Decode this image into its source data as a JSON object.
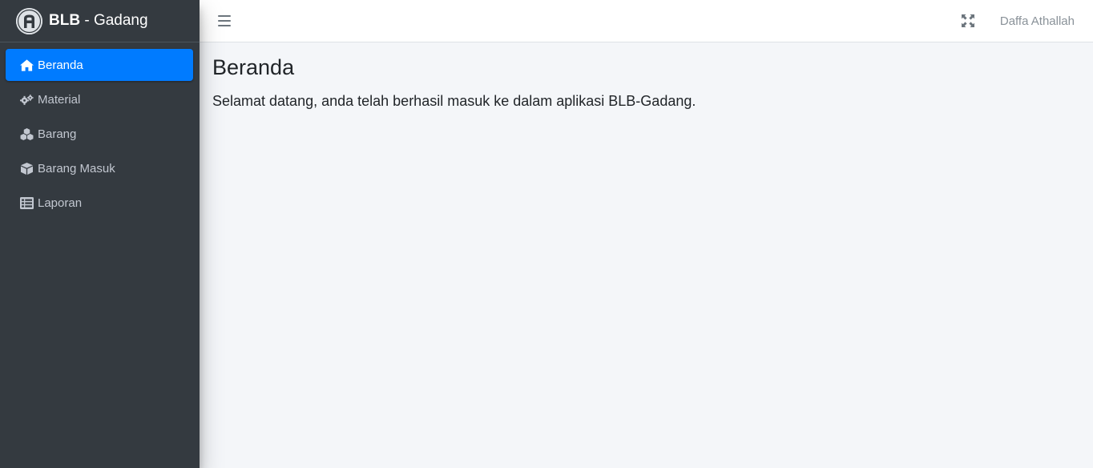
{
  "brand": {
    "bold": "BLB",
    "light": " - Gadang"
  },
  "sidebar": {
    "items": [
      {
        "label": "Beranda",
        "icon": "home-icon"
      },
      {
        "label": "Material",
        "icon": "gears-icon"
      },
      {
        "label": "Barang",
        "icon": "cubes-icon"
      },
      {
        "label": "Barang Masuk",
        "icon": "box-icon"
      },
      {
        "label": "Laporan",
        "icon": "list-icon"
      }
    ],
    "active_index": 0
  },
  "topbar": {
    "user_name": "Daffa Athallah"
  },
  "main": {
    "title": "Beranda",
    "welcome": "Selamat datang, anda telah berhasil masuk ke dalam aplikasi BLB-Gadang."
  },
  "colors": {
    "sidebar_bg": "#343a40",
    "active_item": "#007bff",
    "content_bg": "#f4f6f9"
  }
}
